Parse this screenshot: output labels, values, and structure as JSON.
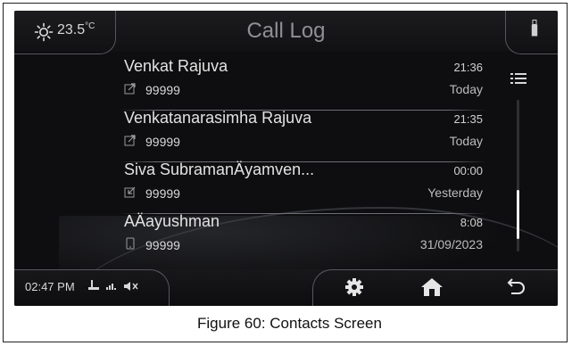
{
  "header": {
    "temperature": "23.5",
    "temperature_unit": "°C",
    "title": "Call Log"
  },
  "call_log": [
    {
      "name": "Venkat Rajuva",
      "number": "99999",
      "time": "21:36",
      "date": "Today",
      "call_type": "outgoing"
    },
    {
      "name": "Venkatanarasimha Rajuva",
      "number": "99999",
      "time": "21:35",
      "date": "Today",
      "call_type": "outgoing"
    },
    {
      "name": "Siva SubramanÄyamven...",
      "number": "99999",
      "time": "00:00",
      "date": "Yesterday",
      "call_type": "incoming"
    },
    {
      "name": "AÄayushman",
      "number": "99999",
      "time": "8:08",
      "date": "31/09/2023",
      "call_type": "mobile"
    }
  ],
  "scroll": {
    "position": 0.55
  },
  "status_bar": {
    "clock": "02:47 PM",
    "icons": [
      "usb-icon",
      "signal-icon",
      "mute-icon"
    ]
  },
  "nav_buttons": [
    "settings-icon",
    "home-icon",
    "back-icon"
  ],
  "colors": {
    "screen_bg": "#0e0e10",
    "text": "#e2e2e2",
    "title": "#8f9096",
    "scroll_thumb": "#f2f2f2"
  },
  "caption": "Figure 60: Contacts Screen"
}
